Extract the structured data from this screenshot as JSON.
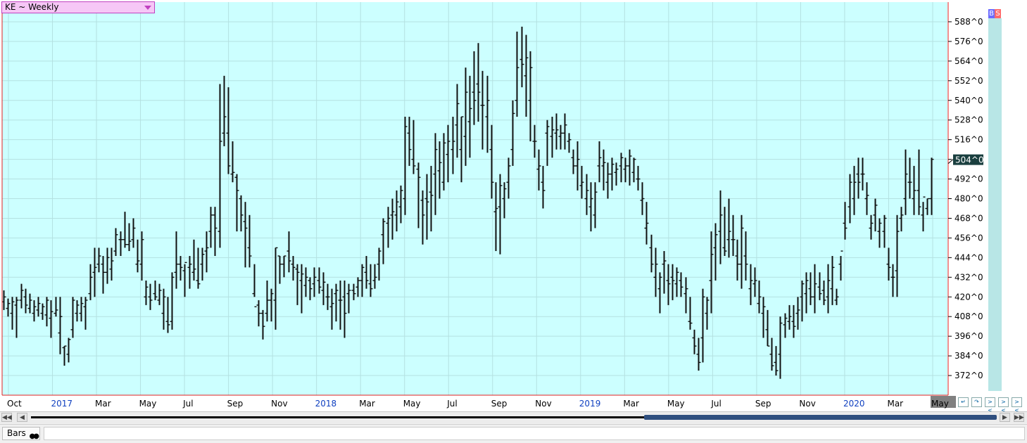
{
  "symbol_selector": {
    "label": "KE ~ Weekly"
  },
  "trade_buttons": {
    "buy": "B",
    "sell": "S"
  },
  "status_bar": {
    "tab_label": "Bars"
  },
  "colors": {
    "plot_bg": "#ccffff",
    "grid": "#b4e1e1",
    "bars": "#101010",
    "axis_red": "#e02020",
    "last_price_bg": "#1a3f3f",
    "year_label": "#1040c0",
    "scroll_thumb": "#2f4f7f"
  },
  "chart_data": {
    "type": "ohlc",
    "title": "",
    "xlabel": "",
    "ylabel": "",
    "ylim": [
      360,
      600
    ],
    "y_tick_values": [
      372,
      384,
      396,
      408,
      420,
      432,
      444,
      456,
      468,
      480,
      492,
      504,
      516,
      528,
      540,
      552,
      564,
      576,
      588
    ],
    "y_tick_labels": [
      "372^0",
      "384^0",
      "396^0",
      "408^0",
      "420^0",
      "432^0",
      "444^0",
      "456^0",
      "468^0",
      "480^0",
      "492^0",
      "504^0",
      "516^0",
      "528^0",
      "540^0",
      "552^0",
      "564^0",
      "576^0",
      "588^0"
    ],
    "last_price_label": "504^0",
    "last_price_value": 504,
    "x_labels": [
      {
        "text": "Oct",
        "year": false
      },
      {
        "text": "2017",
        "year": true
      },
      {
        "text": "Mar",
        "year": false
      },
      {
        "text": "May",
        "year": false
      },
      {
        "text": "Jul",
        "year": false
      },
      {
        "text": "Sep",
        "year": false
      },
      {
        "text": "Nov",
        "year": false
      },
      {
        "text": "2018",
        "year": true
      },
      {
        "text": "Mar",
        "year": false
      },
      {
        "text": "May",
        "year": false
      },
      {
        "text": "Jul",
        "year": false
      },
      {
        "text": "Sep",
        "year": false
      },
      {
        "text": "Nov",
        "year": false
      },
      {
        "text": "2019",
        "year": true
      },
      {
        "text": "Mar",
        "year": false
      },
      {
        "text": "May",
        "year": false
      },
      {
        "text": "Jul",
        "year": false
      },
      {
        "text": "Sep",
        "year": false
      },
      {
        "text": "Nov",
        "year": false
      },
      {
        "text": "2020",
        "year": true
      },
      {
        "text": "Mar",
        "year": false
      },
      {
        "text": "May",
        "year": false
      }
    ],
    "bars": [
      [
        424,
        412,
        417,
        420
      ],
      [
        419,
        408,
        413,
        416
      ],
      [
        420,
        400,
        410,
        417
      ],
      [
        420,
        395,
        415,
        418
      ],
      [
        428,
        413,
        418,
        424
      ],
      [
        425,
        410,
        420,
        415
      ],
      [
        422,
        410,
        413,
        418
      ],
      [
        418,
        405,
        410,
        414
      ],
      [
        420,
        408,
        412,
        416
      ],
      [
        416,
        406,
        410,
        414
      ],
      [
        420,
        402,
        409,
        418
      ],
      [
        418,
        395,
        407,
        411
      ],
      [
        420,
        408,
        410,
        412
      ],
      [
        420,
        385,
        398,
        408
      ],
      [
        390,
        378,
        389,
        390
      ],
      [
        395,
        380,
        385,
        394
      ],
      [
        420,
        395,
        400,
        418
      ],
      [
        418,
        405,
        410,
        415
      ],
      [
        420,
        405,
        410,
        416
      ],
      [
        420,
        400,
        414,
        418
      ],
      [
        440,
        418,
        422,
        432
      ],
      [
        450,
        420,
        435,
        438
      ],
      [
        450,
        435,
        440,
        445
      ],
      [
        445,
        422,
        440,
        435
      ],
      [
        450,
        428,
        435,
        444
      ],
      [
        450,
        430,
        437,
        442
      ],
      [
        462,
        445,
        448,
        458
      ],
      [
        460,
        445,
        455,
        455
      ],
      [
        472,
        450,
        455,
        452
      ],
      [
        465,
        448,
        452,
        454
      ],
      [
        468,
        450,
        455,
        462
      ],
      [
        455,
        435,
        440,
        442
      ],
      [
        460,
        430,
        440,
        455
      ],
      [
        430,
        415,
        420,
        426
      ],
      [
        428,
        412,
        420,
        418
      ],
      [
        430,
        418,
        422,
        420
      ],
      [
        428,
        415,
        418,
        424
      ],
      [
        425,
        400,
        410,
        420
      ],
      [
        420,
        398,
        405,
        403
      ],
      [
        435,
        400,
        405,
        432
      ],
      [
        460,
        425,
        435,
        440
      ],
      [
        445,
        430,
        440,
        438
      ],
      [
        440,
        420,
        436,
        441
      ],
      [
        445,
        425,
        438,
        440
      ],
      [
        455,
        430,
        435,
        437
      ],
      [
        450,
        425,
        430,
        428
      ],
      [
        450,
        430,
        440,
        446
      ],
      [
        460,
        435,
        448,
        450
      ],
      [
        475,
        450,
        460,
        470
      ],
      [
        475,
        445,
        470,
        462
      ],
      [
        550,
        450,
        460,
        515
      ],
      [
        555,
        512,
        520,
        530
      ],
      [
        548,
        495,
        520,
        500
      ],
      [
        515,
        490,
        495,
        496
      ],
      [
        495,
        460,
        493,
        485
      ],
      [
        482,
        460,
        480,
        470
      ],
      [
        478,
        438,
        466,
        462
      ],
      [
        470,
        438,
        450,
        445
      ],
      [
        440,
        420,
        422,
        414
      ],
      [
        418,
        402,
        415,
        410
      ],
      [
        412,
        394,
        410,
        402
      ],
      [
        430,
        405,
        410,
        418
      ],
      [
        425,
        405,
        418,
        422
      ],
      [
        450,
        400,
        418,
        450
      ],
      [
        445,
        428,
        445,
        440
      ],
      [
        445,
        432,
        440,
        445
      ],
      [
        460,
        435,
        448,
        442
      ],
      [
        445,
        430,
        440,
        438
      ],
      [
        440,
        415,
        437,
        435
      ],
      [
        440,
        410,
        430,
        434
      ],
      [
        438,
        420,
        427,
        432
      ],
      [
        432,
        418,
        430,
        425
      ],
      [
        438,
        420,
        428,
        432
      ],
      [
        438,
        422,
        430,
        426
      ],
      [
        435,
        415,
        424,
        429
      ],
      [
        428,
        412,
        420,
        420
      ],
      [
        425,
        400,
        414,
        416
      ],
      [
        428,
        405,
        422,
        424
      ],
      [
        430,
        400,
        418,
        418
      ],
      [
        430,
        395,
        420,
        410
      ],
      [
        428,
        410,
        422,
        424
      ],
      [
        428,
        418,
        424,
        422
      ],
      [
        432,
        420,
        426,
        430
      ],
      [
        440,
        420,
        430,
        438
      ],
      [
        445,
        425,
        435,
        430
      ],
      [
        440,
        420,
        428,
        425
      ],
      [
        440,
        425,
        430,
        432
      ],
      [
        450,
        430,
        440,
        448
      ],
      [
        468,
        440,
        458,
        466
      ],
      [
        475,
        450,
        465,
        468
      ],
      [
        480,
        455,
        470,
        472
      ],
      [
        485,
        460,
        470,
        478
      ],
      [
        488,
        465,
        475,
        485
      ],
      [
        530,
        470,
        480,
        524
      ],
      [
        530,
        500,
        520,
        510
      ],
      [
        528,
        495,
        504,
        500
      ],
      [
        502,
        462,
        498,
        493
      ],
      [
        485,
        452,
        479,
        470
      ],
      [
        495,
        455,
        480,
        478
      ],
      [
        500,
        460,
        484,
        482
      ],
      [
        520,
        470,
        495,
        510
      ],
      [
        515,
        480,
        497,
        502
      ],
      [
        520,
        485,
        490,
        514
      ],
      [
        525,
        490,
        507,
        515
      ],
      [
        530,
        495,
        510,
        515
      ],
      [
        550,
        505,
        525,
        538
      ],
      [
        530,
        490,
        510,
        530
      ],
      [
        560,
        500,
        518,
        545
      ],
      [
        555,
        505,
        527,
        535
      ],
      [
        570,
        525,
        545,
        540
      ],
      [
        575,
        527,
        550,
        545
      ],
      [
        558,
        510,
        537,
        537
      ],
      [
        555,
        508,
        530,
        540
      ],
      [
        525,
        480,
        510,
        490
      ],
      [
        490,
        448,
        472,
        474
      ],
      [
        495,
        446,
        475,
        488
      ],
      [
        490,
        468,
        480,
        486
      ],
      [
        505,
        480,
        490,
        500
      ],
      [
        540,
        500,
        510,
        532
      ],
      [
        582,
        530,
        540,
        560
      ],
      [
        585,
        548,
        565,
        562
      ],
      [
        580,
        530,
        555,
        566
      ],
      [
        570,
        515,
        540,
        560
      ],
      [
        525,
        505,
        515,
        515
      ],
      [
        510,
        485,
        498,
        500
      ],
      [
        500,
        474,
        490,
        485
      ],
      [
        528,
        500,
        520,
        524
      ],
      [
        530,
        505,
        518,
        522
      ],
      [
        532,
        510,
        520,
        522
      ],
      [
        525,
        510,
        518,
        520
      ],
      [
        532,
        510,
        520,
        525
      ],
      [
        520,
        508,
        515,
        516
      ],
      [
        510,
        495,
        505,
        500
      ],
      [
        515,
        485,
        500,
        504
      ],
      [
        500,
        480,
        488,
        490
      ],
      [
        495,
        470,
        480,
        485
      ],
      [
        490,
        460,
        475,
        480
      ],
      [
        490,
        462,
        470,
        484
      ],
      [
        515,
        490,
        500,
        505
      ],
      [
        510,
        485,
        500,
        502
      ],
      [
        502,
        480,
        490,
        495
      ],
      [
        505,
        485,
        495,
        501
      ],
      [
        502,
        488,
        496,
        498
      ],
      [
        508,
        490,
        500,
        505
      ],
      [
        505,
        490,
        498,
        500
      ],
      [
        510,
        488,
        500,
        506
      ],
      [
        505,
        490,
        496,
        504
      ],
      [
        500,
        485,
        492,
        492
      ],
      [
        490,
        470,
        479,
        480
      ],
      [
        478,
        452,
        462,
        465
      ],
      [
        458,
        435,
        450,
        440
      ],
      [
        450,
        420,
        432,
        440
      ],
      [
        435,
        410,
        425,
        432
      ],
      [
        448,
        422,
        440,
        442
      ],
      [
        440,
        415,
        430,
        428
      ],
      [
        440,
        418,
        432,
        430
      ],
      [
        438,
        420,
        428,
        435
      ],
      [
        435,
        420,
        430,
        426
      ],
      [
        432,
        410,
        422,
        425
      ],
      [
        420,
        400,
        405,
        404
      ],
      [
        400,
        385,
        395,
        390
      ],
      [
        395,
        375,
        385,
        380
      ],
      [
        425,
        380,
        395,
        420
      ],
      [
        420,
        400,
        410,
        418
      ],
      [
        460,
        410,
        430,
        446
      ],
      [
        465,
        430,
        450,
        458
      ],
      [
        485,
        440,
        460,
        470
      ],
      [
        475,
        445,
        450,
        448
      ],
      [
        480,
        444,
        455,
        460
      ],
      [
        470,
        445,
        455,
        455
      ],
      [
        455,
        430,
        445,
        440
      ],
      [
        470,
        425,
        440,
        462
      ],
      [
        460,
        430,
        445,
        440
      ],
      [
        440,
        415,
        425,
        430
      ],
      [
        438,
        420,
        428,
        430
      ],
      [
        430,
        410,
        416,
        420
      ],
      [
        420,
        395,
        410,
        414
      ],
      [
        412,
        390,
        400,
        390
      ],
      [
        395,
        375,
        385,
        378
      ],
      [
        390,
        372,
        380,
        375
      ],
      [
        408,
        370,
        385,
        404
      ],
      [
        410,
        395,
        403,
        407
      ],
      [
        415,
        400,
        405,
        408
      ],
      [
        415,
        395,
        405,
        402
      ],
      [
        420,
        400,
        410,
        412
      ],
      [
        430,
        405,
        420,
        428
      ],
      [
        435,
        410,
        422,
        430
      ],
      [
        435,
        415,
        425,
        420
      ],
      [
        440,
        410,
        420,
        428
      ],
      [
        435,
        418,
        426,
        422
      ],
      [
        430,
        415,
        424,
        418
      ],
      [
        440,
        410,
        420,
        430
      ],
      [
        445,
        415,
        425,
        438
      ],
      [
        425,
        415,
        418,
        420
      ],
      [
        445,
        430,
        440,
        448
      ],
      [
        478,
        455,
        465,
        462
      ],
      [
        495,
        465,
        475,
        490
      ],
      [
        500,
        470,
        480,
        490
      ],
      [
        505,
        480,
        495,
        490
      ],
      [
        505,
        485,
        495,
        495
      ],
      [
        490,
        470,
        480,
        482
      ],
      [
        470,
        455,
        462,
        465
      ],
      [
        480,
        460,
        470,
        476
      ],
      [
        468,
        450,
        460,
        465
      ],
      [
        470,
        450,
        460,
        468
      ],
      [
        450,
        430,
        440,
        438
      ],
      [
        440,
        420,
        432,
        432
      ],
      [
        470,
        420,
        436,
        460
      ],
      [
        475,
        460,
        468,
        470
      ],
      [
        510,
        470,
        480,
        495
      ],
      [
        505,
        480,
        490,
        490
      ],
      [
        500,
        470,
        480,
        485
      ],
      [
        510,
        470,
        485,
        475
      ],
      [
        478,
        460,
        470,
        481
      ],
      [
        480,
        470,
        474,
        480
      ],
      [
        505,
        470,
        480,
        504
      ]
    ]
  }
}
